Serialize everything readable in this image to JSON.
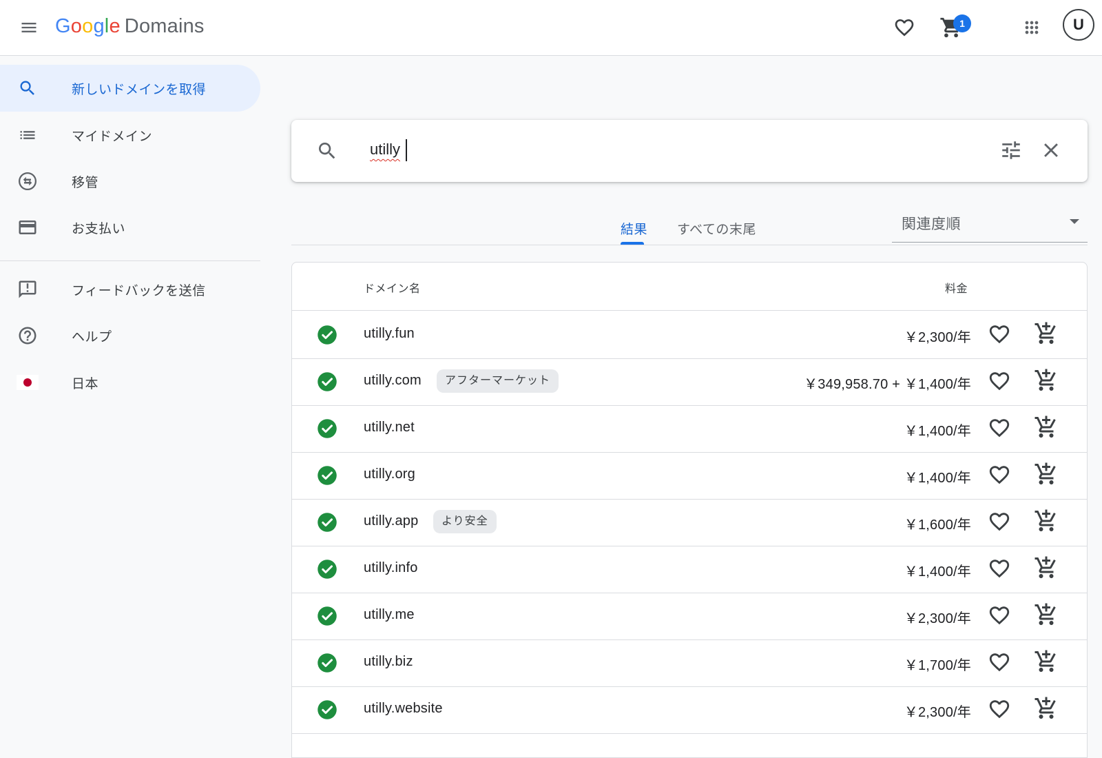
{
  "header": {
    "logo_google": [
      "G",
      "o",
      "o",
      "g",
      "l",
      "e"
    ],
    "logo_product": "Domains",
    "cart_count": "1",
    "avatar_letter": "U",
    "icons": [
      "menu-icon",
      "heart-icon",
      "cart-icon",
      "apps-grid-icon",
      "account-icon"
    ]
  },
  "sidebar": {
    "items": [
      {
        "label": "新しいドメインを取得",
        "icon": "search-icon",
        "active": true
      },
      {
        "label": "マイドメイン",
        "icon": "list-icon"
      },
      {
        "label": "移管",
        "icon": "transfer-icon"
      },
      {
        "label": "お支払い",
        "icon": "credit-card-icon"
      },
      {
        "label": "フィードバックを送信",
        "icon": "feedback-icon"
      },
      {
        "label": "ヘルプ",
        "icon": "help-icon"
      },
      {
        "label": "日本",
        "icon": "japan-flag-icon"
      }
    ]
  },
  "search": {
    "value": "utilly"
  },
  "tabs": [
    {
      "label": "結果",
      "active": true
    },
    {
      "label": "すべての末尾"
    }
  ],
  "sort": {
    "label": "関連度順"
  },
  "table": {
    "col_name": "ドメイン名",
    "col_price": "料金",
    "rows": [
      {
        "domain": "utilly.fun",
        "chip": "",
        "price": "￥2,300/年"
      },
      {
        "domain": "utilly.com",
        "chip": "アフターマーケット",
        "price": "￥349,958.70 + ￥1,400/年"
      },
      {
        "domain": "utilly.net",
        "chip": "",
        "price": "￥1,400/年"
      },
      {
        "domain": "utilly.org",
        "chip": "",
        "price": "￥1,400/年"
      },
      {
        "domain": "utilly.app",
        "chip": "より安全",
        "price": "￥1,600/年"
      },
      {
        "domain": "utilly.info",
        "chip": "",
        "price": "￥1,400/年"
      },
      {
        "domain": "utilly.me",
        "chip": "",
        "price": "￥2,300/年"
      },
      {
        "domain": "utilly.biz",
        "chip": "",
        "price": "￥1,700/年"
      },
      {
        "domain": "utilly.website",
        "chip": "",
        "price": "￥2,300/年"
      }
    ]
  },
  "colors": {
    "accent": "#1a73e8",
    "active_bg": "#e8f0fe",
    "available_green": "#1e8e3e",
    "flag_red": "#bc002d"
  }
}
